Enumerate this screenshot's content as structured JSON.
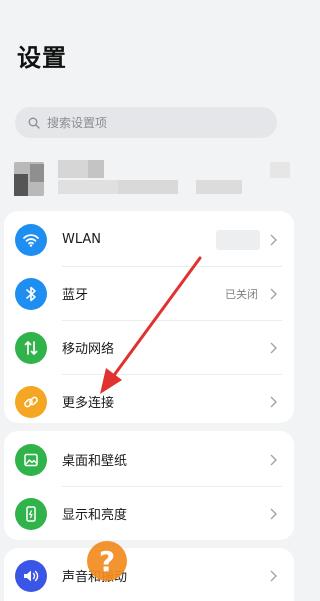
{
  "header": {
    "title": "设置"
  },
  "search": {
    "placeholder": "搜索设置项",
    "icon": "search-icon"
  },
  "settings": {
    "wlan": {
      "label": "WLAN",
      "icon": "wifi-icon",
      "color": "#1f8ef1"
    },
    "bluetooth": {
      "label": "蓝牙",
      "value": "已关闭",
      "icon": "bluetooth-icon",
      "color": "#1f8ef1"
    },
    "mobile_network": {
      "label": "移动网络",
      "icon": "mobile-data-icon",
      "color": "#2fb34a"
    },
    "more_connections": {
      "label": "更多连接",
      "icon": "link-icon",
      "color": "#f5a623"
    },
    "wallpaper": {
      "label": "桌面和壁纸",
      "icon": "image-icon",
      "color": "#2fb34a"
    },
    "display": {
      "label": "显示和亮度",
      "icon": "display-icon",
      "color": "#2fb34a"
    },
    "sound": {
      "label": "声音和振动",
      "icon": "speaker-icon",
      "color": "#3b55e6"
    }
  },
  "overlays": {
    "help_badge_text": "?",
    "arrow_color": "#e0322e"
  }
}
